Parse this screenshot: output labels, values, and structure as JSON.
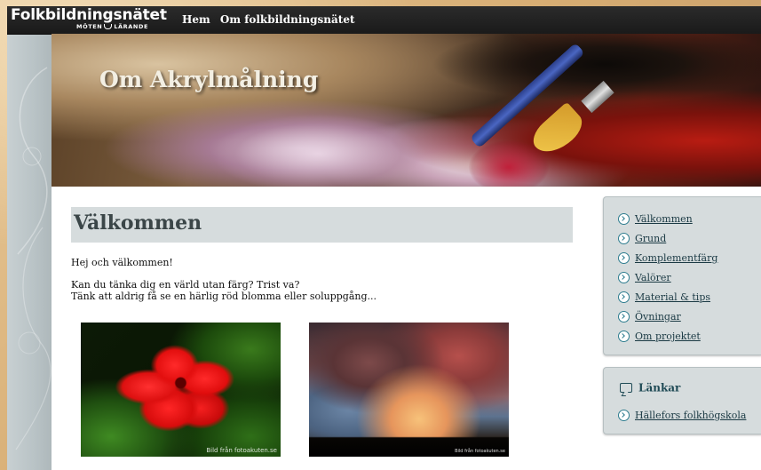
{
  "site": {
    "logo_main": "Folkbildningsnätet",
    "logo_sub_left": "MÖTEN",
    "logo_sub_right": "LÄRANDE"
  },
  "nav": {
    "items": [
      {
        "label": "Hem"
      },
      {
        "label": "Om folkbildningsnätet"
      }
    ]
  },
  "banner": {
    "title": "Om Akrylmålning"
  },
  "main": {
    "heading": "Välkommen",
    "paragraph1": "Hej och välkommen!",
    "paragraph2_line1": "Kan du tänka dig en värld utan färg? Trist va?",
    "paragraph2_line2": "Tänk att aldrig få se en härlig röd blomma eller soluppgång...",
    "images": [
      {
        "caption": "Bild från fotoakuten.se"
      },
      {
        "caption": "Bild från fotoakuten.se"
      }
    ]
  },
  "sidebar": {
    "menu": [
      {
        "label": "Välkommen"
      },
      {
        "label": "Grund"
      },
      {
        "label": "Komplementfärg"
      },
      {
        "label": "Valörer"
      },
      {
        "label": "Material & tips"
      },
      {
        "label": "Övningar"
      },
      {
        "label": "Om projektet"
      }
    ],
    "links_title": "Länkar",
    "links": [
      {
        "label": "Hällefors folkhögskola"
      }
    ]
  },
  "colors": {
    "topbar": "#1a1a1a",
    "panel_bg": "#d6dcdd",
    "heading_bar": "#d6dcdd",
    "link": "#1b3a44",
    "accent": "#2e7d8f"
  },
  "icons": {
    "menu_bullet": "circle-chevron-right-icon",
    "links_header": "speech-bubble-icon"
  }
}
